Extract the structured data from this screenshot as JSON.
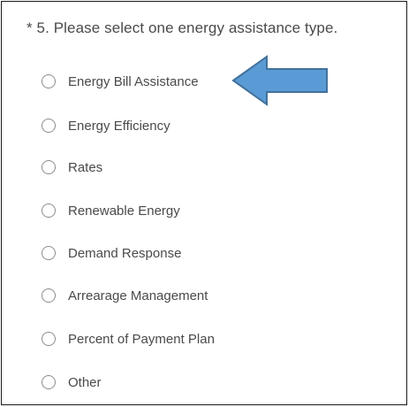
{
  "question": {
    "text": "* 5. Please select one energy assistance type."
  },
  "options": [
    {
      "label": "Energy Bill Assistance"
    },
    {
      "label": "Energy Efficiency"
    },
    {
      "label": "Rates"
    },
    {
      "label": "Renewable Energy"
    },
    {
      "label": "Demand Response"
    },
    {
      "label": "Arrearage Management"
    },
    {
      "label": "Percent of Payment Plan"
    },
    {
      "label": "Other"
    }
  ],
  "colors": {
    "arrow_fill": "#5b9bd5",
    "arrow_stroke": "#41719c",
    "text": "#4a4a4a",
    "radio_border": "#8c8c8c"
  },
  "icons": {
    "annotation": "left-arrow-icon",
    "radio": "radio-unselected-icon"
  }
}
